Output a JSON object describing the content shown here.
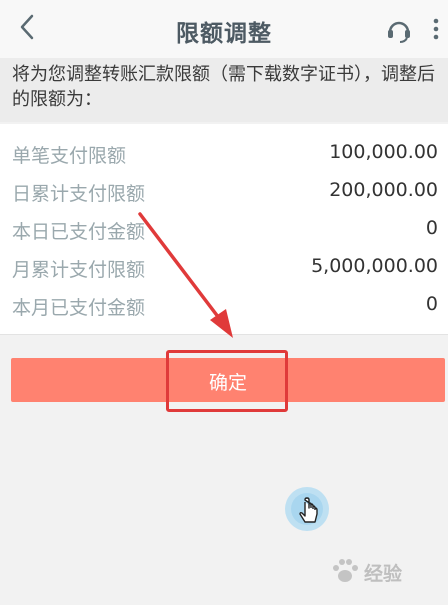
{
  "header": {
    "title": "限额调整",
    "back_icon": "chevron-left-icon",
    "service_icon": "headset-icon",
    "more_icon": "more-vertical-icon"
  },
  "notice": {
    "text": "将为您调整转账汇款限额（需下载数字证书），调整后的限额为："
  },
  "limits": [
    {
      "label": "单笔支付限额",
      "value": "100,000.00"
    },
    {
      "label": "日累计支付限额",
      "value": "200,000.00"
    },
    {
      "label": "本日已支付金额",
      "value": "0"
    },
    {
      "label": "月累计支付限额",
      "value": "5,000,000.00"
    },
    {
      "label": "本月已支付金额",
      "value": "0"
    }
  ],
  "confirm": {
    "label": "确定"
  },
  "watermark": {
    "text": "经验"
  },
  "colors": {
    "accent": "#ff8270",
    "annotation": "#e03a3a",
    "label_gray": "#9aa8ad",
    "title": "#4d5a63"
  }
}
